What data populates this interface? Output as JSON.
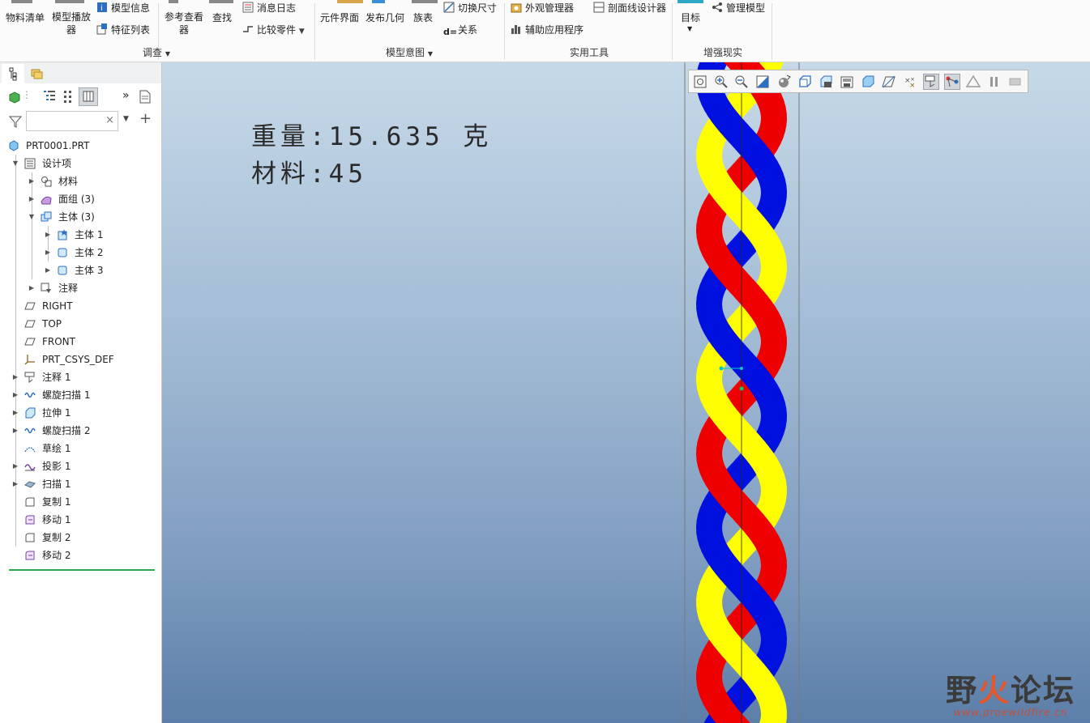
{
  "ribbon": {
    "buttons": {
      "bom": "物料清单",
      "model_player": "模型播放器",
      "model_info": "模型信息",
      "feature_list": "特征列表",
      "ref_viewer": "参考查看器",
      "find": "查找",
      "message_log": "消息日志",
      "compare_part": "比较零件",
      "component_interface": "元件界面",
      "publish_geometry": "发布几何",
      "family_table": "族表",
      "switch_dims": "切换尺寸",
      "relations": "关系",
      "appearance_manager": "外观管理器",
      "section_designer": "剖面线设计器",
      "aux_apps": "辅助应用程序",
      "target": "目标",
      "manage_model": "管理模型"
    },
    "groups": {
      "investigate": "调查",
      "model_intent": "模型意图",
      "utilities": "实用工具",
      "ar": "增强现实"
    }
  },
  "tree": {
    "root": "PRT0001.PRT",
    "items": [
      {
        "label": "设计项",
        "icon": "design-items-icon"
      },
      {
        "label": "材料",
        "icon": "material-icon"
      },
      {
        "label": "面组 (3)",
        "icon": "quilt-icon"
      },
      {
        "label": "主体 (3)",
        "icon": "bodies-icon"
      },
      {
        "label": "主体 1",
        "icon": "body-default-icon"
      },
      {
        "label": "主体 2",
        "icon": "body-icon"
      },
      {
        "label": "主体 3",
        "icon": "body-icon"
      },
      {
        "label": "注释",
        "icon": "annotation-icon"
      },
      {
        "label": "RIGHT",
        "icon": "datum-plane-icon"
      },
      {
        "label": "TOP",
        "icon": "datum-plane-icon"
      },
      {
        "label": "FRONT",
        "icon": "datum-plane-icon"
      },
      {
        "label": "PRT_CSYS_DEF",
        "icon": "csys-icon"
      },
      {
        "label": "注释 1",
        "icon": "annotation-feature-icon"
      },
      {
        "label": "螺旋扫描 1",
        "icon": "helical-sweep-icon"
      },
      {
        "label": "拉伸 1",
        "icon": "extrude-icon"
      },
      {
        "label": "螺旋扫描 2",
        "icon": "helical-sweep-icon"
      },
      {
        "label": "草绘 1",
        "icon": "sketch-icon"
      },
      {
        "label": "投影 1",
        "icon": "projection-icon"
      },
      {
        "label": "扫描 1",
        "icon": "sweep-icon"
      },
      {
        "label": "复制 1",
        "icon": "copy-icon"
      },
      {
        "label": "移动 1",
        "icon": "move-icon"
      },
      {
        "label": "复制 2",
        "icon": "copy-icon"
      },
      {
        "label": "移动 2",
        "icon": "move-icon"
      }
    ]
  },
  "filter": {
    "placeholder": ""
  },
  "viewport": {
    "mass_text": "重量:15.635 克",
    "material_text": "材料:45"
  },
  "watermark": {
    "main_left": "野",
    "main_fire": "火",
    "main_right": "论坛",
    "url": "www.proewildfire.cn"
  },
  "colors": {
    "strand_red": "#f00000",
    "strand_yellow": "#ffff00",
    "strand_blue": "#0010e0",
    "background_top": "#c6d9e8",
    "background_bottom": "#5c7ea8"
  }
}
